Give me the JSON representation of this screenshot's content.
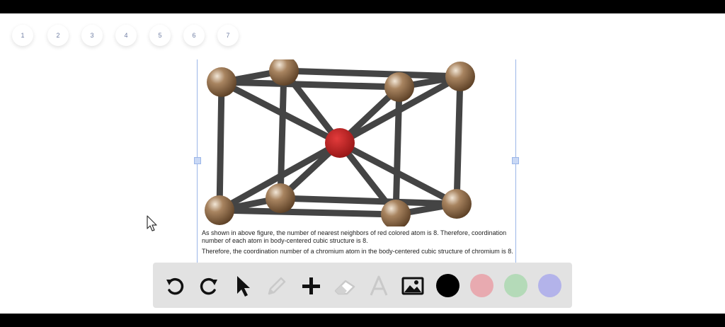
{
  "page_numbers": [
    "1",
    "2",
    "3",
    "4",
    "5",
    "6",
    "7"
  ],
  "caption": {
    "paragraph1": "As shown in above figure, the number of nearest neighbors of red colored atom is 8. Therefore, coordination number of each atom in body-centered cubic structure is 8.",
    "paragraph2": "Therefore, the coordination number of a chromium atom in the body-centered cubic structure of chromium is 8."
  },
  "toolbar": {
    "tools": [
      "undo-icon",
      "redo-icon",
      "pointer-icon",
      "pencil-icon",
      "plus-icon",
      "eraser-icon",
      "text-icon",
      "image-icon"
    ],
    "colors": [
      "#000000",
      "#e8aab0",
      "#b4dab8",
      "#b3b3ea"
    ]
  },
  "figure": {
    "corner_atom_color": "#7a5a3a",
    "center_atom_color": "#b51f1f",
    "bond_color": "#444444"
  }
}
